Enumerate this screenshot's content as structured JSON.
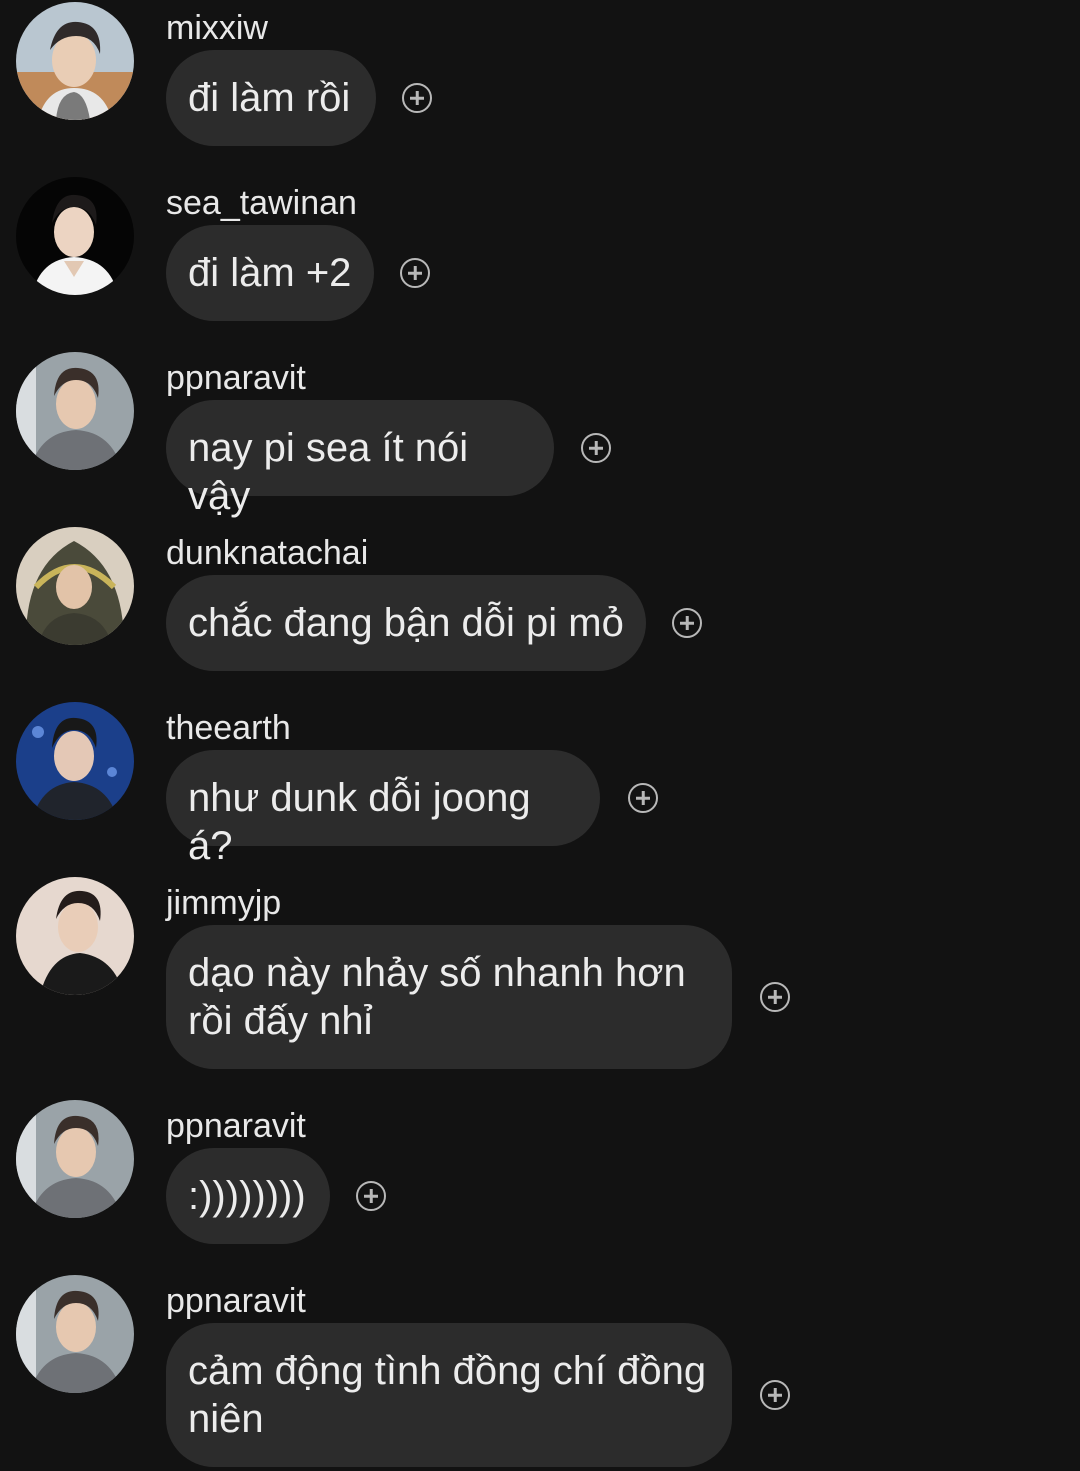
{
  "colors": {
    "background": "#121212",
    "bubble": "#2c2c2c",
    "text": "#ececec",
    "icon": "#b8b8b8"
  },
  "messages": [
    {
      "username": "mixxiw",
      "text": "đi làm rồi",
      "react_icon": "add-reaction-icon"
    },
    {
      "username": "sea_tawinan",
      "text": "đi làm +2",
      "react_icon": "add-reaction-icon"
    },
    {
      "username": "ppnaravit",
      "text": "nay pi sea ít nói vậy",
      "react_icon": "add-reaction-icon"
    },
    {
      "username": "dunknatachai",
      "text": "chắc đang bận dỗi pi mỏ",
      "react_icon": "add-reaction-icon"
    },
    {
      "username": "theearth",
      "text": "như dunk dỗi joong á?",
      "react_icon": "add-reaction-icon"
    },
    {
      "username": "jimmyjp",
      "text": "dạo này nhảy số nhanh hơn\nrồi đấy nhỉ",
      "react_icon": "add-reaction-icon"
    },
    {
      "username": "ppnaravit",
      "text": ":))))))))",
      "react_icon": "add-reaction-icon"
    },
    {
      "username": "ppnaravit",
      "text": "cảm động tình đồng chí đồng\nniên",
      "react_icon": "add-reaction-icon"
    }
  ]
}
